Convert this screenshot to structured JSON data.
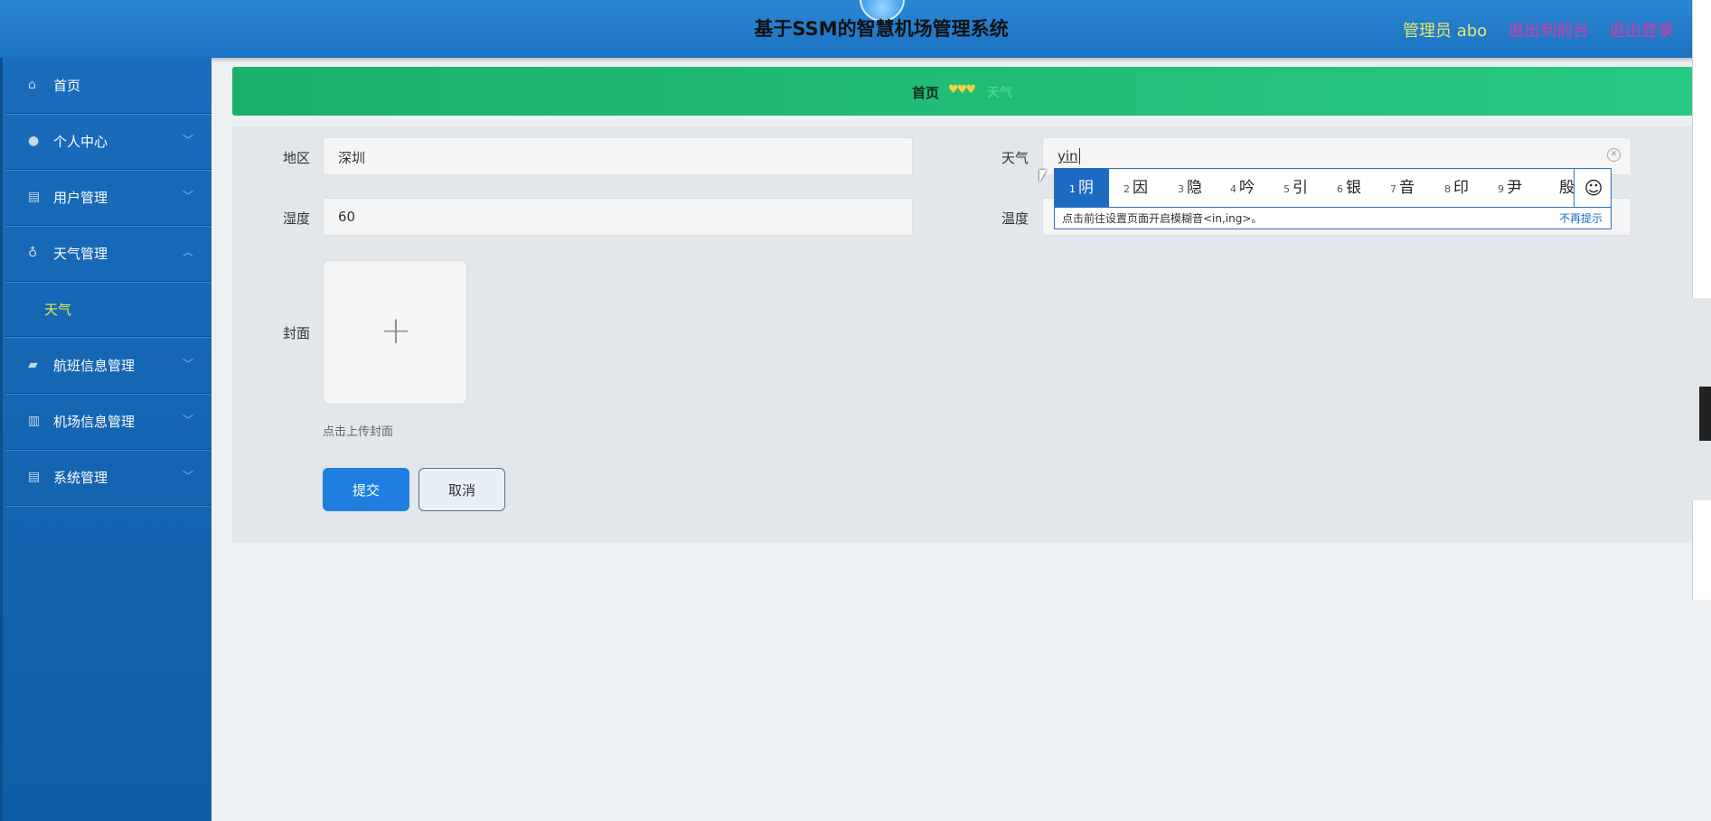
{
  "header": {
    "title": "基于SSM的智慧机场管理系统",
    "admin": "管理员 abo",
    "back_front": "退出到前台",
    "logout": "退出登录"
  },
  "sidebar": {
    "items": [
      {
        "label": "首页",
        "icon": "home-icon"
      },
      {
        "label": "个人中心",
        "icon": "user-icon"
      },
      {
        "label": "用户管理",
        "icon": "clipboard-icon"
      },
      {
        "label": "天气管理",
        "icon": "microphone-icon"
      },
      {
        "label": "航班信息管理",
        "icon": "wallet-icon"
      },
      {
        "label": "机场信息管理",
        "icon": "book-icon"
      },
      {
        "label": "系统管理",
        "icon": "clipboard-icon"
      }
    ],
    "sub_item": "天气"
  },
  "breadcrumb": {
    "home": "首页",
    "hearts": "♥♥♥",
    "ghost": "天气"
  },
  "form": {
    "region_label": "地区",
    "region_value": "深圳",
    "weather_label": "天气",
    "weather_value": "yin",
    "humidity_label": "湿度",
    "humidity_value": "60",
    "temperature_label": "温度",
    "cover_label": "封面",
    "upload_hint": "点击上传封面",
    "submit": "提交",
    "cancel": "取消"
  },
  "ime": {
    "candidates": [
      {
        "n": "1",
        "c": "阴"
      },
      {
        "n": "2",
        "c": "因"
      },
      {
        "n": "3",
        "c": "隐"
      },
      {
        "n": "4",
        "c": "吟"
      },
      {
        "n": "5",
        "c": "引"
      },
      {
        "n": "6",
        "c": "银"
      },
      {
        "n": "7",
        "c": "音"
      },
      {
        "n": "8",
        "c": "印"
      },
      {
        "n": "9",
        "c": "尹"
      },
      {
        "n": "",
        "c": "殷"
      }
    ],
    "tip": "点击前往设置页面开启模糊音<in,ing>。",
    "no_more": "不再提示"
  }
}
